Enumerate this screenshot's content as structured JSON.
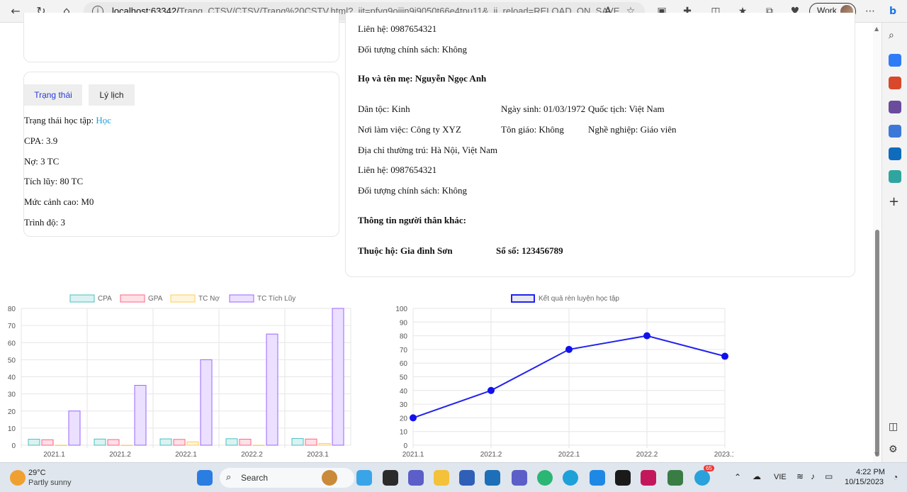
{
  "browser": {
    "url_host": "localhost:63342/",
    "url_rest": "Trang_CTSV/CTSV/Trang%20CSTV.html?_ijt=pfvg9ojjjn9j9050t66e4tpu11&_ij_reload=RELOAD_ON_SAVE",
    "profile_label": "Work"
  },
  "status_card": {
    "tabs": [
      {
        "label": "Trạng thái"
      },
      {
        "label": "Lý lịch"
      }
    ],
    "status_prefix": "Trạng thái học tập: ",
    "status_value": "Học",
    "cpa": "CPA: 3.9",
    "debt": "Nợ: 3 TC",
    "accumulated": "Tích lũy: 80 TC",
    "warning": "Mức cảnh cao: M0",
    "level": "Trình độ: 3"
  },
  "family_card": {
    "father_contact": "Liên hệ: 0987654321",
    "father_policy": "Đối tượng chính sách: Không",
    "mother_title": "Họ và tên mẹ: Nguyễn Ngọc Anh",
    "mother_ethnicity": "Dân tộc: Kinh",
    "mother_birth": "Ngày sinh: 01/03/1972",
    "mother_nationality": "Quốc tịch: Việt Nam",
    "mother_workplace": "Nơi làm việc: Công ty XYZ",
    "mother_religion": "Tôn giáo: Không",
    "mother_job": "Nghề nghiệp: Giáo viên",
    "mother_address": "Địa chỉ thường trú: Hà Nội, Việt Nam",
    "mother_contact": "Liên hệ: 0987654321",
    "mother_policy": "Đối tượng chính sách: Không",
    "relatives_title": "Thông tin người thân khác:",
    "household": "Thuộc hộ: Gia đình Sơn",
    "book_no": "Sổ số: 123456789"
  },
  "chart_data": [
    {
      "type": "bar",
      "categories": [
        "2021.1",
        "2021.2",
        "2022.1",
        "2022.2",
        "2023.1"
      ],
      "series": [
        {
          "name": "CPA",
          "values": [
            3.5,
            3.6,
            3.7,
            3.8,
            3.9
          ],
          "color": "#4bc0c0",
          "fill": "#dbf2f2"
        },
        {
          "name": "GPA",
          "values": [
            3.2,
            3.3,
            3.4,
            3.5,
            3.6
          ],
          "color": "#ff6384",
          "fill": "#ffe0e6"
        },
        {
          "name": "TC Nợ",
          "values": [
            0,
            0,
            2,
            0,
            1
          ],
          "color": "#ffcd56",
          "fill": "#fff5dd"
        },
        {
          "name": "TC Tích Lũy",
          "values": [
            20,
            35,
            50,
            65,
            80
          ],
          "color": "#9966ff",
          "fill": "#ebe0ff"
        }
      ],
      "ylim": [
        0,
        80
      ],
      "yticks": [
        0,
        10,
        20,
        30,
        40,
        50,
        60,
        70,
        80
      ],
      "grid": true,
      "legend": "top"
    },
    {
      "type": "line",
      "categories": [
        "2021.1",
        "2021.2",
        "2022.1",
        "2022.2",
        "2023.1"
      ],
      "series": [
        {
          "name": "Kết quả rèn luyện học tập",
          "values": [
            20,
            40,
            70,
            80,
            65
          ],
          "color": "#2222ee"
        }
      ],
      "ylim": [
        0,
        100
      ],
      "yticks": [
        0,
        10,
        20,
        30,
        40,
        50,
        60,
        70,
        80,
        90,
        100
      ],
      "grid": true,
      "legend": "top"
    }
  ],
  "taskbar": {
    "temperature": "29°C",
    "weather": "Partly sunny",
    "search_label": "Search",
    "language": "VIE",
    "time": "4:22 PM",
    "date": "10/15/2023",
    "badge": "65"
  }
}
